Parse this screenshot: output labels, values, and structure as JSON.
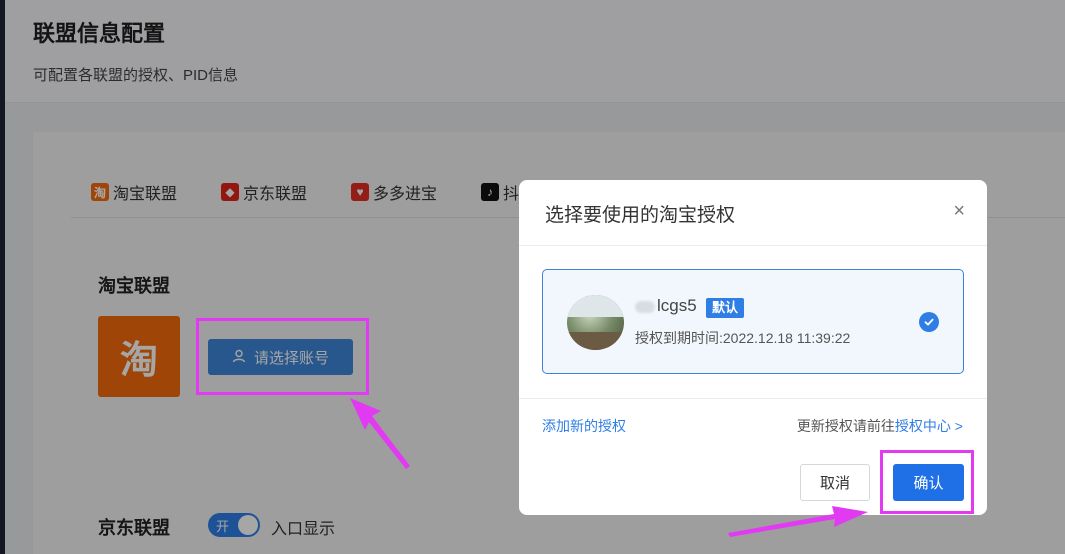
{
  "page": {
    "title": "联盟信息配置",
    "subtitle": "可配置各联盟的授权、PID信息"
  },
  "tabs": [
    {
      "label": "淘宝联盟",
      "icon": "taobao-icon",
      "color": "#f36a0b"
    },
    {
      "label": "京东联盟",
      "icon": "jd-icon",
      "color": "#e2231a"
    },
    {
      "label": "多多进宝",
      "icon": "pdd-icon",
      "color": "#e02e24"
    },
    {
      "label": "抖",
      "icon": "douyin-icon",
      "color": "#111111"
    }
  ],
  "taobao_section": {
    "title": "淘宝联盟",
    "logo_char": "淘",
    "select_account_label": "请选择账号"
  },
  "jd_section": {
    "title": "京东联盟",
    "toggle_label": "开",
    "toggle_on": true,
    "toggle_text": "入口显示"
  },
  "modal": {
    "title": "选择要使用的淘宝授权",
    "close_icon": "×",
    "account": {
      "name": "lcgs5",
      "badge": "默认",
      "expire": "授权到期时间:2022.12.18 11:39:22",
      "selected": true
    },
    "add_auth_label": "添加新的授权",
    "update_prefix": "更新授权请前往",
    "update_link": "授权中心 >",
    "cancel_label": "取消",
    "confirm_label": "确认"
  },
  "colors": {
    "primary": "#2f7ee6",
    "highlight": "#e23af2",
    "taobao_orange": "#f36a0b"
  }
}
